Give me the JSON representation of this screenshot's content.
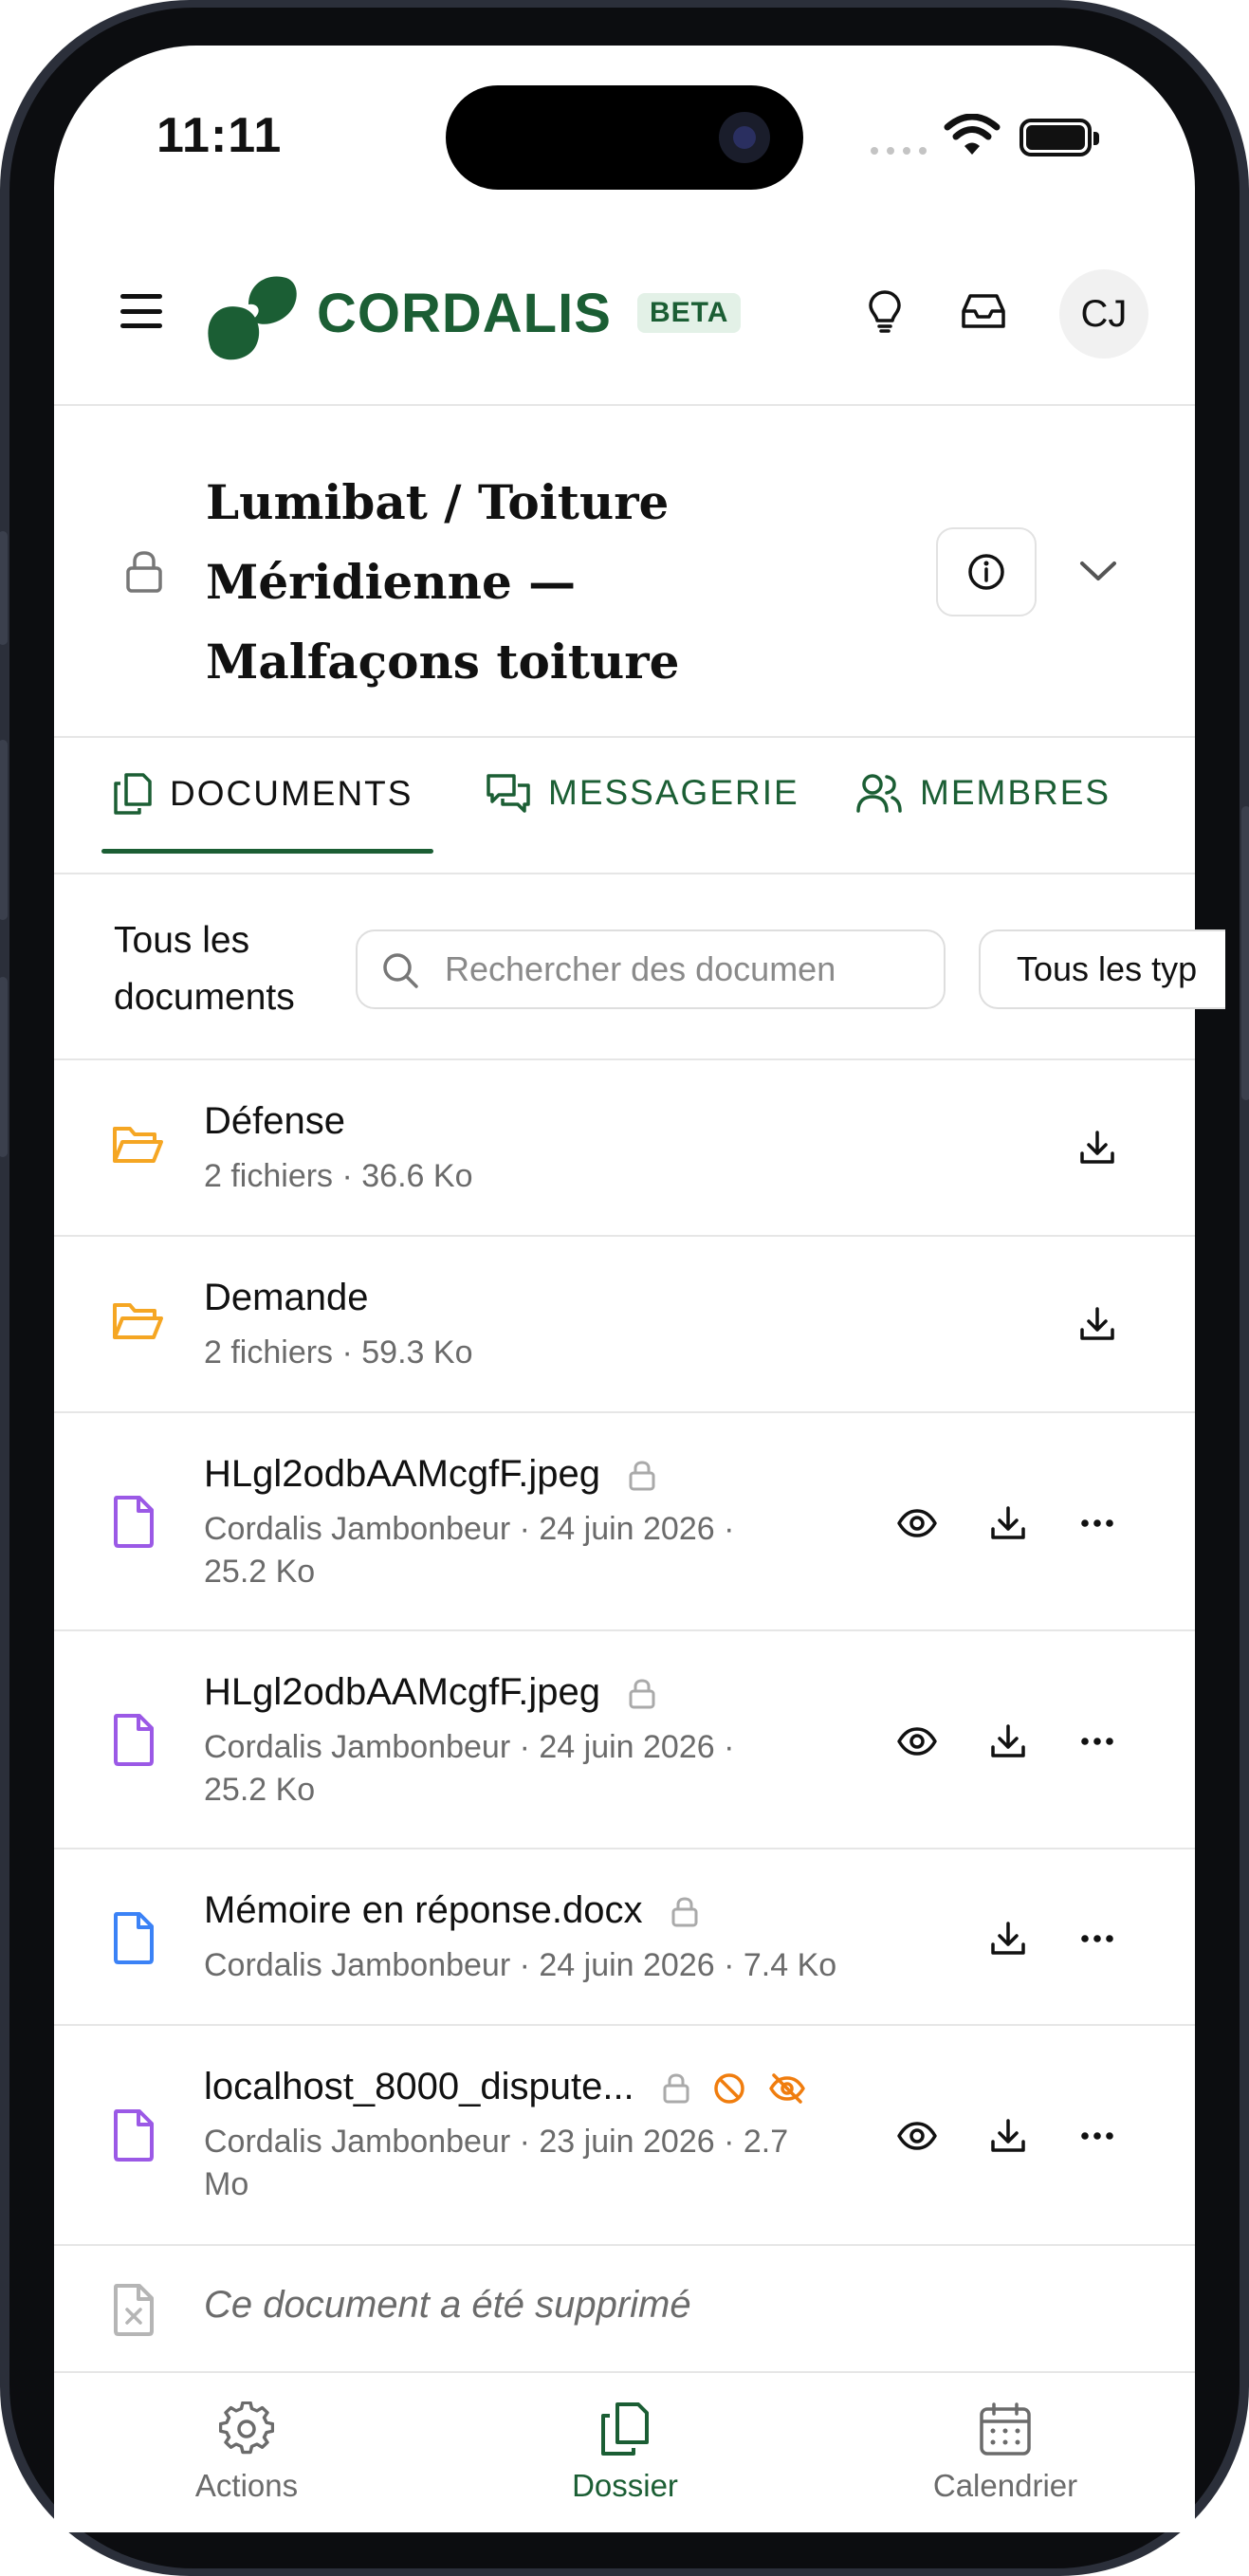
{
  "status_bar": {
    "time": "11:11"
  },
  "header": {
    "brand": "CORDALIS",
    "badge": "BETA",
    "avatar_initials": "CJ",
    "brand_color": "#1b5e34"
  },
  "case": {
    "title": "Lumibat / Toiture Méridienne — Malfaçons toiture"
  },
  "tabs": [
    {
      "label": "DOCUMENTS",
      "active": true
    },
    {
      "label": "MESSAGERIE",
      "active": false
    },
    {
      "label": "MEMBRES",
      "active": false
    }
  ],
  "filter": {
    "label": "Tous les documents",
    "search_placeholder": "Rechercher des documen",
    "type_select": "Tous les typ"
  },
  "folders": [
    {
      "name": "Défense",
      "meta": "2 fichiers · 36.6 Ko",
      "icon": "folder-icon"
    },
    {
      "name": "Demande",
      "meta": "2 fichiers · 59.3 Ko",
      "icon": "folder-icon"
    }
  ],
  "files": [
    {
      "name": "HLgl2odbAAMcgfF.jpeg",
      "meta": "Cordalis Jambonbeur · 24 juin 2026 · 25.2 Ko",
      "icon": "file-icon",
      "color": "#9b59e6"
    },
    {
      "name": "HLgl2odbAAMcgfF.jpeg",
      "meta": "Cordalis Jambonbeur · 24 juin 2026 · 25.2 Ko",
      "icon": "file-icon",
      "color": "#9b59e6"
    },
    {
      "name": "Mémoire en réponse.docx",
      "meta": "Cordalis Jambonbeur · 24 juin 2026 · 7.4 Ko",
      "icon": "file-icon",
      "color": "#3b82f6"
    },
    {
      "name": "localhost_8000_dispute...",
      "meta": "Cordalis Jambonbeur · 23 juin 2026 · 2.7 Mo",
      "icon": "file-icon",
      "color": "#9b59e6"
    }
  ],
  "deleted": {
    "text": "Ce document a été supprimé"
  },
  "bottom_nav": [
    {
      "label": "Actions",
      "icon": "gear-icon",
      "active": false
    },
    {
      "label": "Dossier",
      "icon": "documents-icon",
      "active": true
    },
    {
      "label": "Calendrier",
      "icon": "calendar-icon",
      "active": false
    }
  ],
  "colors": {
    "accent": "#1b5e34",
    "folder": "#f5a623",
    "warning": "#f07d0e",
    "muted_text": "#6b6b6b"
  }
}
